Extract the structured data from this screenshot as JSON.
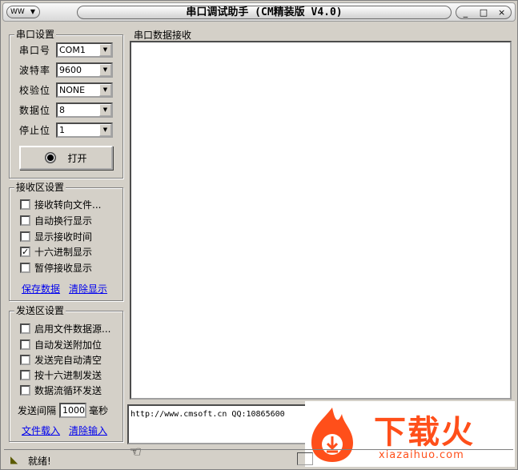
{
  "window": {
    "title": "串口调试助手 (CM精装版 V4.0)",
    "sys_icon": "WW",
    "controls": {
      "minimize": "_",
      "maximize": "□",
      "close": "×"
    }
  },
  "serial_settings": {
    "title": "串口设置",
    "port": {
      "label": "串口号",
      "value": "COM1"
    },
    "baud": {
      "label": "波特率",
      "value": "9600"
    },
    "parity": {
      "label": "校验位",
      "value": "NONE"
    },
    "databits": {
      "label": "数据位",
      "value": "8"
    },
    "stopbits": {
      "label": "停止位",
      "value": "1"
    },
    "open_button": "打开"
  },
  "receive_settings": {
    "title": "接收区设置",
    "options": [
      {
        "label": "接收转向文件...",
        "checked": false
      },
      {
        "label": "自动换行显示",
        "checked": false
      },
      {
        "label": "显示接收时间",
        "checked": false
      },
      {
        "label": "十六进制显示",
        "checked": true
      },
      {
        "label": "暂停接收显示",
        "checked": false
      }
    ],
    "save_link": "保存数据",
    "clear_link": "清除显示"
  },
  "send_settings": {
    "title": "发送区设置",
    "options": [
      {
        "label": "启用文件数据源...",
        "checked": false
      },
      {
        "label": "自动发送附加位",
        "checked": false
      },
      {
        "label": "发送完自动清空",
        "checked": false
      },
      {
        "label": "按十六进制发送",
        "checked": false
      },
      {
        "label": "数据流循环发送",
        "checked": false
      }
    ],
    "interval_label": "发送间隔",
    "interval_value": "1000",
    "interval_unit": "毫秒",
    "load_link": "文件载入",
    "clear_link": "清除输入"
  },
  "receive_panel": {
    "title": "串口数据接收"
  },
  "send_panel": {
    "text": "http://www.cmsoft.cn QQ:10865600"
  },
  "status": {
    "text": "就绪!"
  },
  "watermark": {
    "name": "下载火",
    "url": "xiazaihuo.com"
  },
  "colors": {
    "link": "#0000ee",
    "logo": "#ff4f1a",
    "face": "#d4d0c8"
  }
}
